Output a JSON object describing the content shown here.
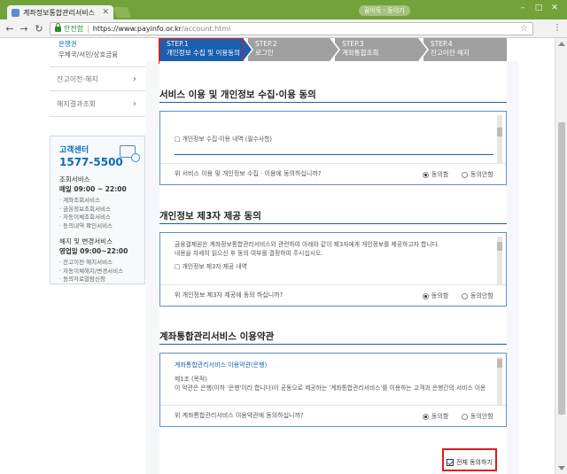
{
  "browser": {
    "tab_title": "계좌정보통합관리서비스",
    "ext_label": "꿈이득 - 둥이기",
    "secure_label": "안전함",
    "url_host": "https://www.payinfo.or.kr",
    "url_path": "/account.html"
  },
  "sidebar": {
    "sub_items": [
      "은행권",
      "우체국/서민/상호금융"
    ],
    "menus": [
      "잔고이전·해지",
      "해지결과조회"
    ],
    "cs": {
      "title": "고객센터",
      "phone": "1577-5500",
      "hours_label_1": "조회서비스",
      "hours_1": "매일 09:00 ~ 22:00",
      "items_1": [
        "계좌조회서비스",
        "금융정보조회서비스",
        "자동이체조회서비스",
        "동의내역 확인서비스"
      ],
      "hours_label_2": "해지 및 변경서비스",
      "hours_2": "영업일 09:00~22:00",
      "items_2": [
        "잔고이전·해지서비스",
        "자동이체해지/변경서비스",
        "동의자료열람신청"
      ]
    }
  },
  "steps": [
    {
      "num": "STEP.1",
      "label": "개인정보 수집 및 이용동의"
    },
    {
      "num": "STEP.2",
      "label": "로그인"
    },
    {
      "num": "STEP.3",
      "label": "계좌통합조회"
    },
    {
      "num": "STEP.4",
      "label": "잔고이전·해지"
    }
  ],
  "sections": [
    {
      "title": "서비스 이용 및 개인정보 수집·이용 동의",
      "body": [
        "□ 개인정보 수집·이용 내역 (필수사항)"
      ],
      "question": "위 서비스 이용 및 개인정보 수집 · 이용에 동의하십니까?",
      "agree": "동의함",
      "disagree": "동의안함"
    },
    {
      "title": "개인정보 제3자 제공 동의",
      "body": [
        "금융결제원은 계좌정보통합관리서비스와 관련하여 아래와 같이 제3자에게 개인정보를 제공하고자 합니다.",
        "내용을 자세히 읽으신 후 동의 여부를 결정하여 주시십시오.",
        "□ 개인정보 제3자 제공 내역"
      ],
      "question": "위 개인정보 제3자 제공에 동의 하십니까?",
      "agree": "동의함",
      "disagree": "동의안함"
    },
    {
      "title": "계좌통합관리서비스 이용약관",
      "link": "계좌통합관리서비스 이용약관(은행)",
      "body": [
        "제1조 (목적)",
        "이 약관은 은행(이하 '은행'이라 합니다)이 공동으로 제공하는 '계좌통합관리서비스'를 이용하는 고객과 은행간의 서비스 이용에 관한 제반 사항을"
      ],
      "question": "위 계좌통합관리서비스 이용약관에 동의하십니까?",
      "agree": "동의함",
      "disagree": "동의안함"
    }
  ],
  "agree_all_label": "전체 동의하기"
}
